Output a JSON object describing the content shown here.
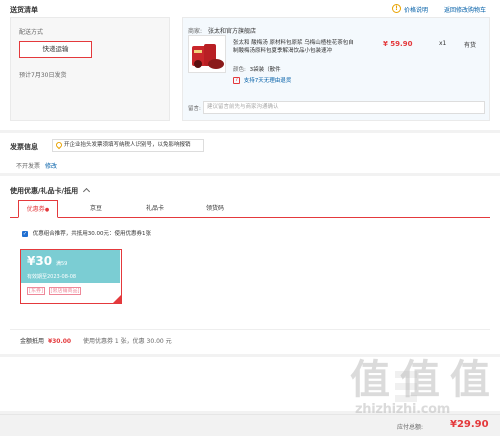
{
  "shipping": {
    "title": "送货清单",
    "price_notice": "价格说明",
    "back_cart": "返回修改购物车",
    "method_label": "配送方式",
    "express": "快递运输",
    "pre_ship": "预计7月30日发货",
    "shop_label": "商家:",
    "shop_name": "张太和官方旗舰店",
    "product_title": "张太和 酸梅汤 原材料包原浆 乌梅山楂桂花茶包自制酸梅汤原料包夏季解渴饮品小包装速冲",
    "price": "¥ 59.90",
    "qty": "x1",
    "stock": "有货",
    "color_label": "颜色:",
    "color_value": "3袋装（散件",
    "seven_day": "支持7天无理由退货",
    "remark_label": "留言:",
    "remark_placeholder": "建议留言前先与商家沟通确认"
  },
  "invoice": {
    "title": "发票信息",
    "notice": "开企业抬头发票须填写纳税人识别号，以免影响报销",
    "none": "不开发票",
    "edit": "修改"
  },
  "coupon": {
    "title": "使用优惠/礼品卡/抵用",
    "tabs": [
      "优惠券",
      "京豆",
      "礼品卡",
      "领货码"
    ],
    "combo_text": "优惠组合推荐，共抵用30.00元：使用优惠券1张",
    "amount": "¥30",
    "condition": "满59",
    "expiry": "有效期至2023-08-08",
    "tag1": "[东券]",
    "tag2": "[限店铺商品]",
    "discount_label": "金额抵用",
    "discount_value": "¥30.00",
    "discount_detail": "使用优惠券 1 张，优惠 30.00 元"
  },
  "footer": {
    "pay_label": "应付总额:",
    "pay_amount": "¥29.90"
  },
  "watermark": {
    "big": "值 值 值",
    "url": "zhizhizhi.com"
  },
  "colors": {
    "accent_red": "#e4393c",
    "link_blue": "#005ea7",
    "coupon_teal": "#7bcdd3"
  }
}
